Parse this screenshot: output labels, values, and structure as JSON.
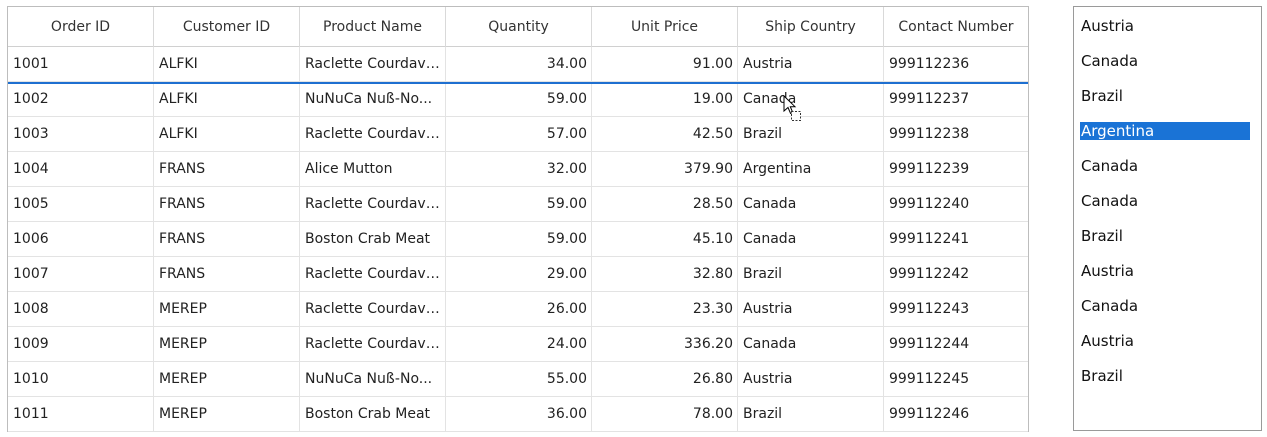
{
  "grid": {
    "columns": [
      "Order ID",
      "Customer ID",
      "Product Name",
      "Quantity",
      "Unit Price",
      "Ship Country",
      "Contact Number"
    ],
    "rows": [
      [
        "1001",
        "ALFKI",
        "Raclette  Courdava...",
        "34.00",
        "91.00",
        "Austria",
        "999112236"
      ],
      [
        "1002",
        "ALFKI",
        "NuNuCa  Nuß-No...",
        "59.00",
        "19.00",
        "Canada",
        "999112237"
      ],
      [
        "1003",
        "ALFKI",
        "Raclette  Courdava...",
        "57.00",
        "42.50",
        "Brazil",
        "999112238"
      ],
      [
        "1004",
        "FRANS",
        "Alice Mutton",
        "32.00",
        "379.90",
        "Argentina",
        "999112239"
      ],
      [
        "1005",
        "FRANS",
        "Raclette  Courdava...",
        "59.00",
        "28.50",
        "Canada",
        "999112240"
      ],
      [
        "1006",
        "FRANS",
        "Boston Crab Meat",
        "59.00",
        "45.10",
        "Canada",
        "999112241"
      ],
      [
        "1007",
        "FRANS",
        "Raclette  Courdava...",
        "29.00",
        "32.80",
        "Brazil",
        "999112242"
      ],
      [
        "1008",
        "MEREP",
        "Raclette  Courdava...",
        "26.00",
        "23.30",
        "Austria",
        "999112243"
      ],
      [
        "1009",
        "MEREP",
        "Raclette  Courdava...",
        "24.00",
        "336.20",
        "Canada",
        "999112244"
      ],
      [
        "1010",
        "MEREP",
        "NuNuCa  Nuß-No...",
        "55.00",
        "26.80",
        "Austria",
        "999112245"
      ],
      [
        "1011",
        "MEREP",
        "Boston Crab Meat",
        "36.00",
        "78.00",
        "Brazil",
        "999112246"
      ]
    ]
  },
  "listbox": {
    "items": [
      "Austria",
      "Canada",
      "Brazil",
      "Argentina",
      "Canada",
      "Canada",
      "Brazil",
      "Austria",
      "Canada",
      "Austria",
      "Brazil"
    ],
    "selected_index": 3,
    "selection_color": "#1a73d6"
  },
  "drag": {
    "cursor_icon": "drag-copy-cursor-icon",
    "drop_indicator_color": "#1e6fd0"
  }
}
